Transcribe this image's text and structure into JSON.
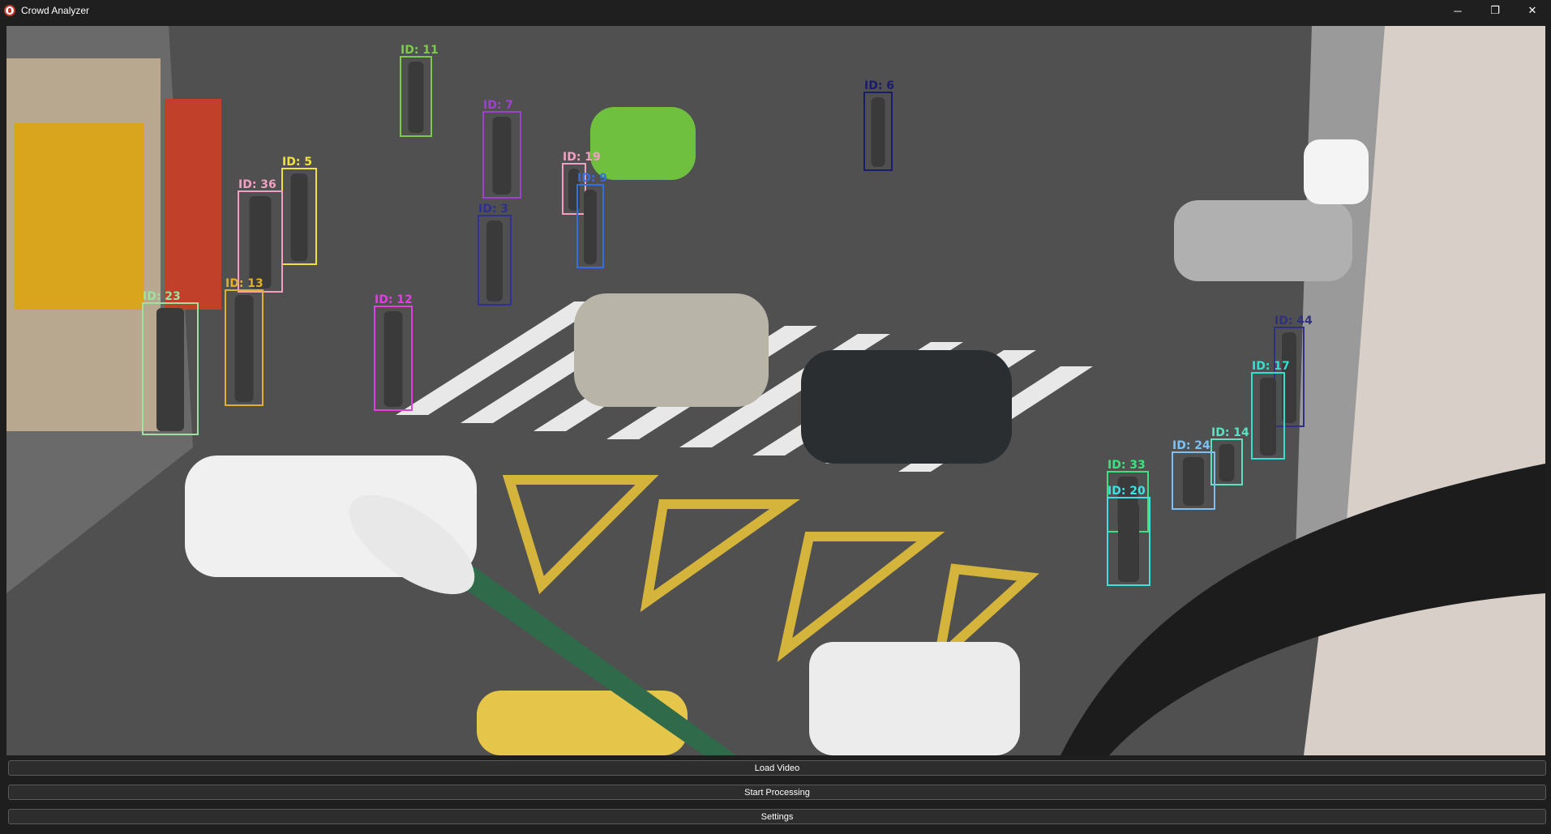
{
  "window": {
    "title": "Crowd Analyzer",
    "controls": {
      "minimize": "─",
      "maximize": "❐",
      "close": "✕"
    }
  },
  "video": {
    "tracks": [
      {
        "id": "ID: 11",
        "color": "#7ec850"
      },
      {
        "id": "ID: 6",
        "color": "#1a1a6e"
      },
      {
        "id": "ID: 7",
        "color": "#a040d0"
      },
      {
        "id": "ID: 5",
        "color": "#f0e040"
      },
      {
        "id": "ID: 19",
        "color": "#f0a0c0"
      },
      {
        "id": "ID: 9",
        "color": "#3070e0"
      },
      {
        "id": "ID: 36",
        "color": "#f0a0c0"
      },
      {
        "id": "ID: 3",
        "color": "#303090"
      },
      {
        "id": "ID: 23",
        "color": "#a0e0a0"
      },
      {
        "id": "ID: 13",
        "color": "#e0b030"
      },
      {
        "id": "ID: 12",
        "color": "#e040e0"
      },
      {
        "id": "ID: 44",
        "color": "#303080"
      },
      {
        "id": "ID: 17",
        "color": "#30e0d0"
      },
      {
        "id": "ID: 14",
        "color": "#60e0c0"
      },
      {
        "id": "ID: 24",
        "color": "#80c0f0"
      },
      {
        "id": "ID: 33",
        "color": "#40e080"
      },
      {
        "id": "ID: 20",
        "color": "#40e0e0"
      }
    ]
  },
  "buttons": {
    "load_video": "Load Video",
    "start_processing": "Start Processing",
    "settings": "Settings"
  }
}
